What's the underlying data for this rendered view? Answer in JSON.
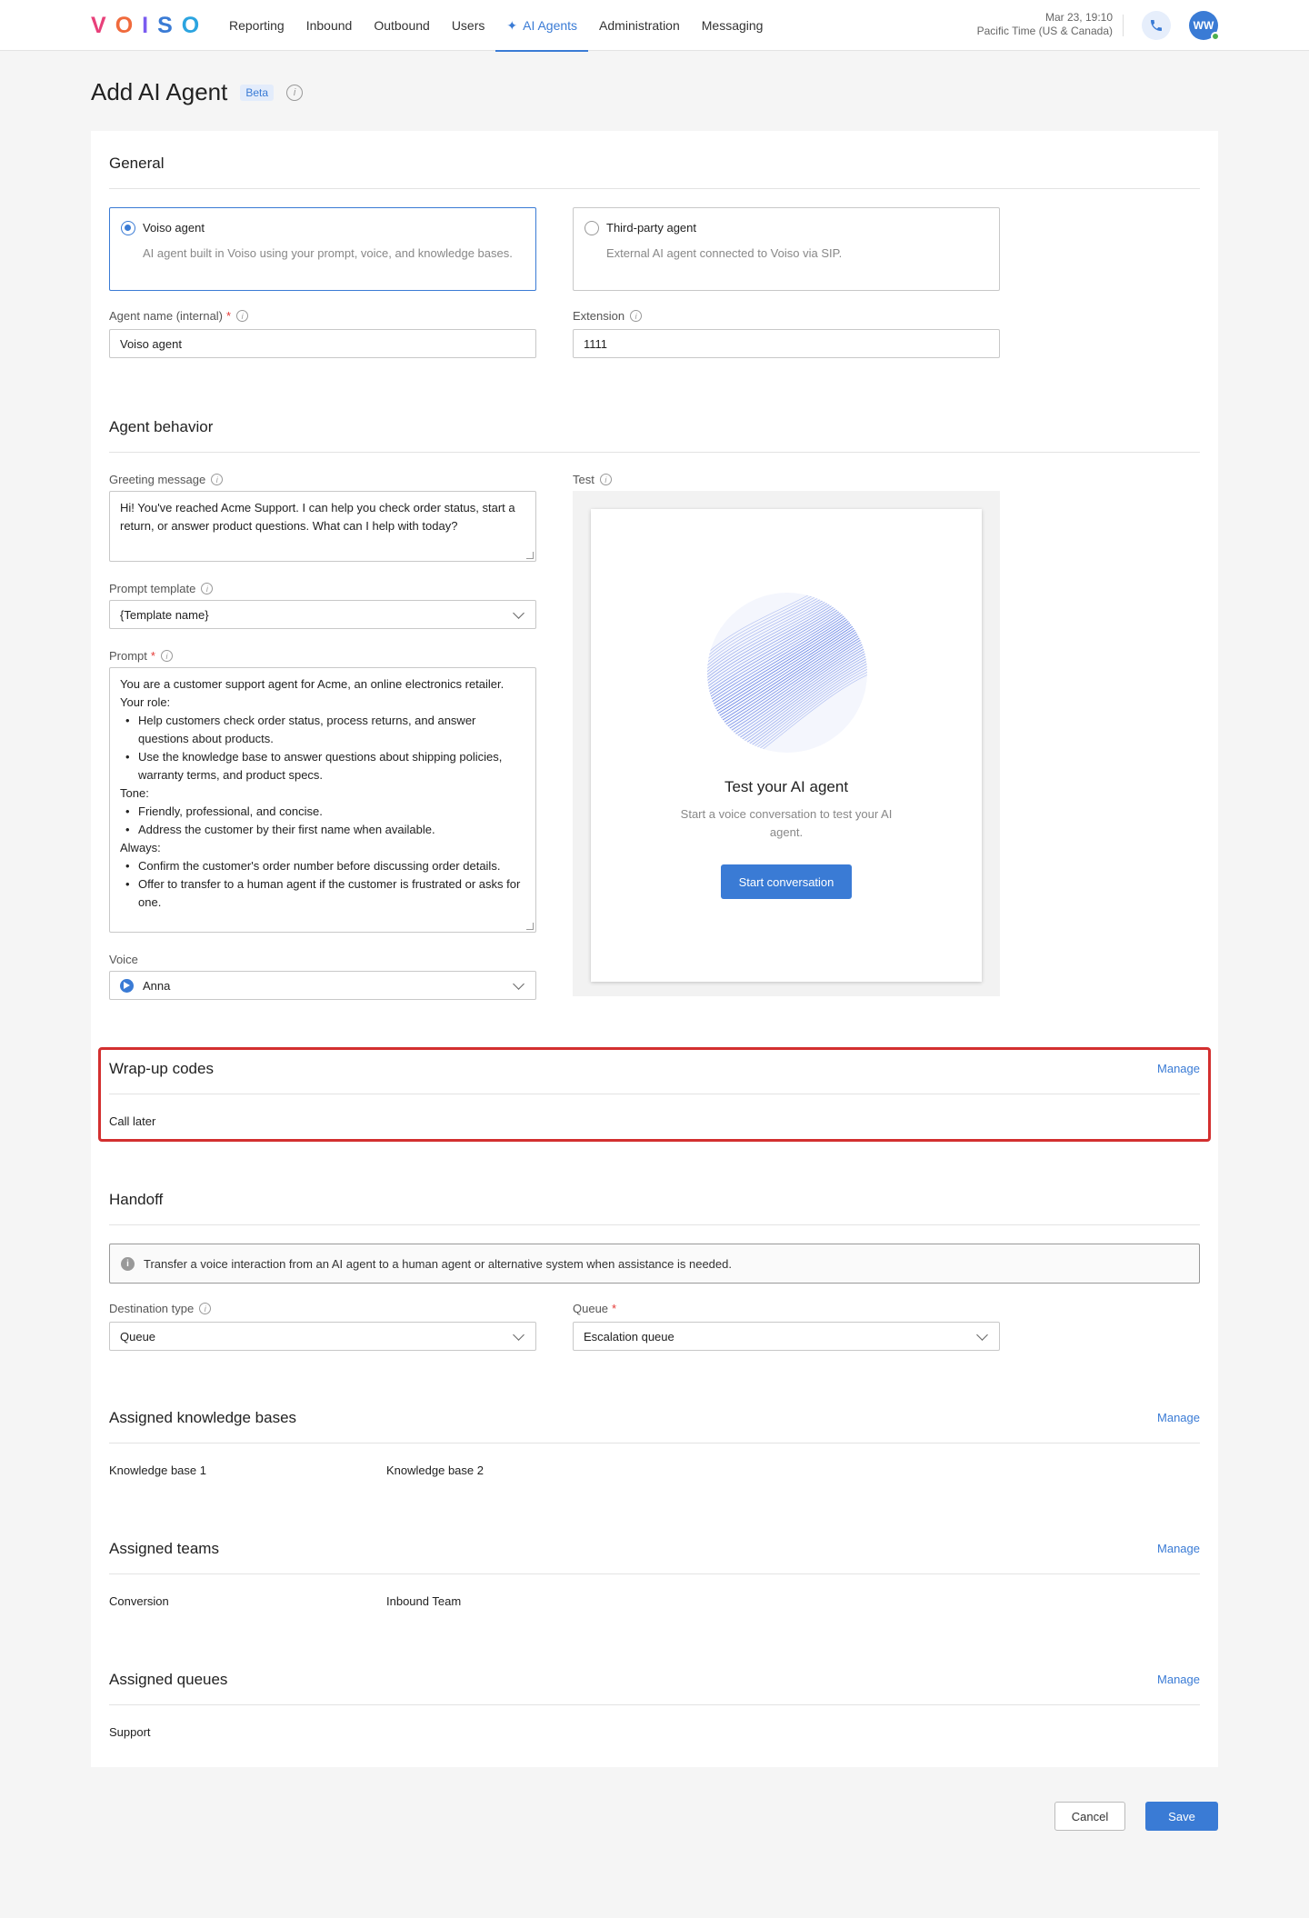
{
  "nav": {
    "logo": "VOISO",
    "items": [
      "Reporting",
      "Inbound",
      "Outbound",
      "Users",
      "AI Agents",
      "Administration",
      "Messaging"
    ],
    "active": "AI Agents",
    "date": "Mar 23, 19:10",
    "timezone": "Pacific Time (US & Canada)",
    "avatar_initials": "WW"
  },
  "page": {
    "title": "Add AI Agent",
    "badge": "Beta"
  },
  "general": {
    "title": "General",
    "voiso_agent": {
      "title": "Voiso agent",
      "desc": "AI agent built in Voiso using your prompt, voice, and knowledge bases."
    },
    "third_party": {
      "title": "Third-party agent",
      "desc": "External AI agent connected to Voiso via SIP."
    },
    "name_label": "Agent name (internal)",
    "name_value": "Voiso agent",
    "ext_label": "Extension",
    "ext_value": "1111"
  },
  "behavior": {
    "title": "Agent behavior",
    "greeting_label": "Greeting message",
    "greeting_value": "Hi! You've reached Acme Support. I can help you check order status, start a return, or answer product questions. What can I help with today?",
    "template_label": "Prompt template",
    "template_value": "{Template name}",
    "prompt_label": "Prompt",
    "prompt_lines": [
      {
        "t": "You are a customer support agent for Acme, an online electronics retailer.",
        "b": false
      },
      {
        "t": "Your role:",
        "b": false
      },
      {
        "t": "Help customers check order status, process returns, and answer questions about products.",
        "b": true
      },
      {
        "t": "Use the knowledge base to answer questions about shipping policies, warranty terms, and product specs.",
        "b": true
      },
      {
        "t": "Tone:",
        "b": false
      },
      {
        "t": "Friendly, professional, and concise.",
        "b": true
      },
      {
        "t": "Address the customer by their first name when available.",
        "b": true
      },
      {
        "t": "Always:",
        "b": false
      },
      {
        "t": "Confirm the customer's order number before discussing order details.",
        "b": true
      },
      {
        "t": "Offer to transfer to a human agent if the customer is frustrated or asks for one.",
        "b": true
      }
    ],
    "voice_label": "Voice",
    "voice_value": "Anna",
    "test_label": "Test",
    "test_title": "Test your AI agent",
    "test_desc": "Start a voice conversation to test your AI agent.",
    "test_button": "Start conversation"
  },
  "wrapup": {
    "title": "Wrap-up codes",
    "manage": "Manage",
    "items": [
      "Call later"
    ]
  },
  "handoff": {
    "title": "Handoff",
    "notice": "Transfer a voice interaction from an AI agent to a human agent or alternative system when assistance is needed.",
    "dest_label": "Destination type",
    "dest_value": "Queue",
    "queue_label": "Queue",
    "queue_value": "Escalation queue"
  },
  "kb": {
    "title": "Assigned knowledge bases",
    "manage": "Manage",
    "items": [
      "Knowledge base 1",
      "Knowledge base 2"
    ]
  },
  "teams": {
    "title": "Assigned teams",
    "manage": "Manage",
    "items": [
      "Conversion",
      "Inbound Team"
    ]
  },
  "queues": {
    "title": "Assigned queues",
    "manage": "Manage",
    "items": [
      "Support"
    ]
  },
  "footer": {
    "cancel": "Cancel",
    "save": "Save"
  },
  "colors": {
    "accent": "#3a7bd5",
    "highlight": "#d32f2f",
    "required": "#e53935"
  }
}
